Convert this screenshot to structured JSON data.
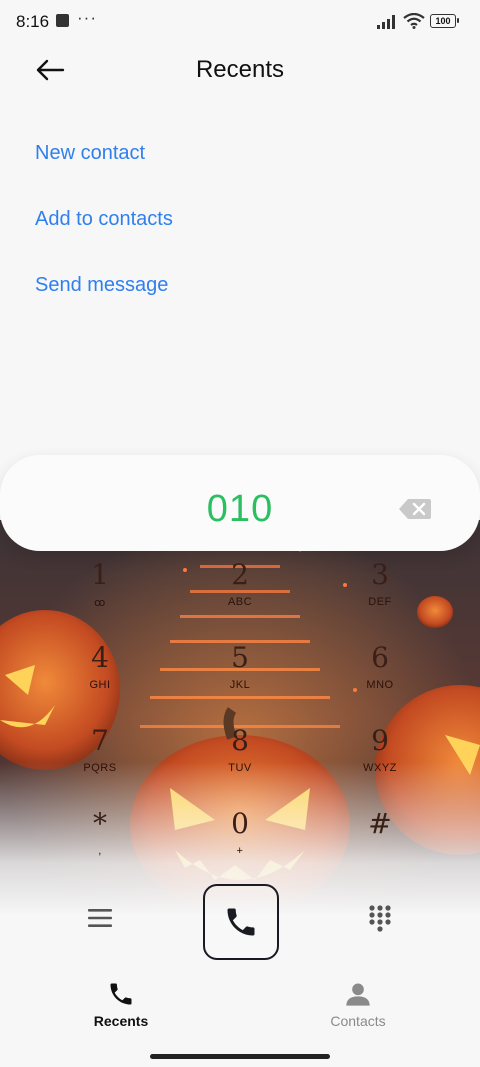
{
  "status": {
    "time": "8:16",
    "overflow": "···",
    "battery": "100",
    "icons": [
      "notification-square-icon",
      "signal-icon",
      "wifi-icon",
      "battery-icon"
    ]
  },
  "header": {
    "title": "Recents",
    "back_icon": "arrow-left-icon"
  },
  "actions": [
    {
      "label": "New contact"
    },
    {
      "label": "Add to contacts"
    },
    {
      "label": "Send message"
    }
  ],
  "dialer": {
    "number": "010",
    "keys": [
      {
        "digit": "1",
        "letters": "ꝏ"
      },
      {
        "digit": "2",
        "letters": "ABC"
      },
      {
        "digit": "3",
        "letters": "DEF"
      },
      {
        "digit": "4",
        "letters": "GHI"
      },
      {
        "digit": "5",
        "letters": "JKL"
      },
      {
        "digit": "6",
        "letters": "MNO"
      },
      {
        "digit": "7",
        "letters": "PQRS"
      },
      {
        "digit": "8",
        "letters": "TUV"
      },
      {
        "digit": "9",
        "letters": "WXYZ"
      },
      {
        "digit": "*",
        "letters": ","
      },
      {
        "digit": "0",
        "letters": "+"
      },
      {
        "digit": "#",
        "letters": ""
      }
    ]
  },
  "bottom_nav": [
    {
      "label": "Recents",
      "icon": "phone-icon",
      "active": true
    },
    {
      "label": "Contacts",
      "icon": "person-icon",
      "active": false
    }
  ],
  "colors": {
    "accent": "#2f80ed",
    "number": "#2bbf62",
    "active_nav": "#111111",
    "inactive_nav": "#8a8a8a"
  }
}
